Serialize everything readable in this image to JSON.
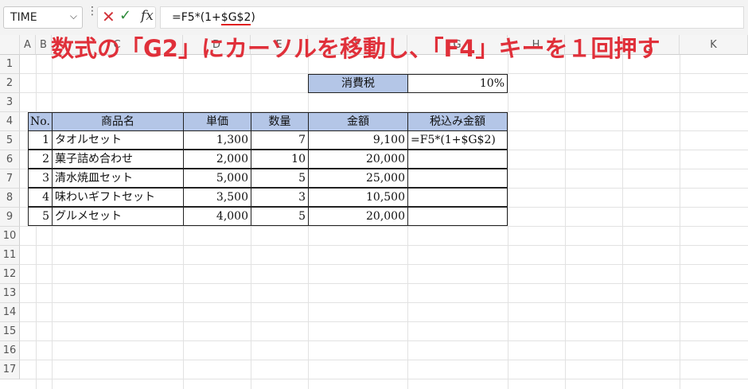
{
  "formula_bar": {
    "name_box": "TIME",
    "formula_prefix": "=F5*(1+",
    "formula_highlight": "$G$2",
    "formula_suffix": ")"
  },
  "overlay_title": "数式の「G2」にカーソルを移動し、「F4」キーを１回押す",
  "columns": [
    "A",
    "B",
    "C",
    "D",
    "E",
    "F",
    "G",
    "H",
    "I",
    "J",
    "K"
  ],
  "rows": [
    "1",
    "2",
    "3",
    "4",
    "5",
    "6",
    "7",
    "8",
    "9",
    "10",
    "11",
    "12",
    "13",
    "14",
    "15",
    "16",
    "17"
  ],
  "tax": {
    "label": "消費税",
    "value": "10%"
  },
  "table": {
    "headers": [
      "No.",
      "商品名",
      "単価",
      "数量",
      "金額",
      "税込み金額"
    ],
    "rows": [
      [
        "1",
        "タオルセット",
        "1,300",
        "7",
        "9,100",
        "=F5*(1+$G$2)"
      ],
      [
        "2",
        "菓子詰め合わせ",
        "2,000",
        "10",
        "20,000",
        ""
      ],
      [
        "3",
        "清水焼皿セット",
        "5,000",
        "5",
        "25,000",
        ""
      ],
      [
        "4",
        "味わいギフトセット",
        "3,500",
        "3",
        "10,500",
        ""
      ],
      [
        "5",
        "グルメセット",
        "4,000",
        "5",
        "20,000",
        ""
      ]
    ]
  },
  "colors": {
    "header_fill": "#b4c6e7",
    "overlay_text": "#e0303a"
  }
}
